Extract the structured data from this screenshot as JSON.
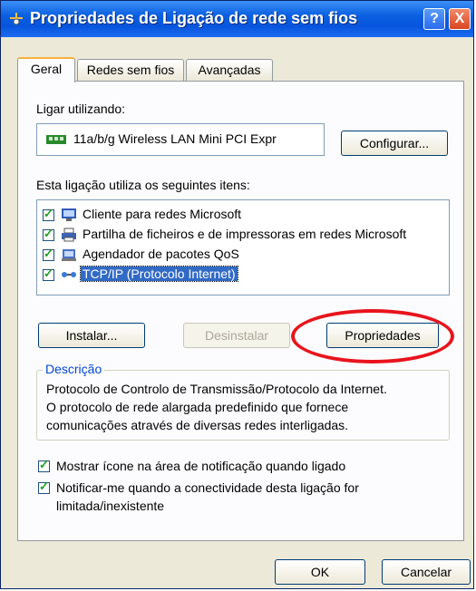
{
  "window": {
    "title": "Propriedades de Ligação de rede sem fios",
    "help_label": "?",
    "close_label": "X"
  },
  "tabs": [
    "Geral",
    "Redes sem fios",
    "Avançadas"
  ],
  "connect_using": {
    "label": "Ligar utilizando:",
    "adapter": "11a/b/g Wireless LAN Mini PCI Expr",
    "configure_button": "Configurar..."
  },
  "items": {
    "label": "Esta ligação utiliza os seguintes itens:",
    "list": [
      {
        "label": "Cliente para redes Microsoft",
        "checked": true,
        "icon": "network-client-icon"
      },
      {
        "label": "Partilha de ficheiros e de impressoras em redes Microsoft",
        "checked": true,
        "icon": "printer-share-icon"
      },
      {
        "label": "Agendador de pacotes QoS",
        "checked": true,
        "icon": "qos-scheduler-icon"
      },
      {
        "label": "TCP/IP (Protocolo Internet)",
        "checked": true,
        "icon": "protocol-icon",
        "selected": true
      }
    ]
  },
  "buttons": {
    "install": "Instalar...",
    "uninstall": "Desinstalar",
    "properties": "Propriedades"
  },
  "description": {
    "title": "Descrição",
    "text_line1": "Protocolo de Controlo de Transmissão/Protocolo da Internet.",
    "text_line2": "O protocolo de rede alargada predefinido que fornece",
    "text_line3": "comunicações através de diversas redes interligadas."
  },
  "options": {
    "show_icon": "Mostrar ícone na área de notificação quando ligado",
    "notify_line1": "Notificar-me quando a conectividade desta ligação for",
    "notify_line2": "limitada/inexistente",
    "show_icon_checked": true,
    "notify_checked": true
  },
  "footer": {
    "ok": "OK",
    "cancel": "Cancelar"
  },
  "colors": {
    "annotation": "#e8141c",
    "titlebar": "#0855dd",
    "selection": "#316ac5"
  }
}
